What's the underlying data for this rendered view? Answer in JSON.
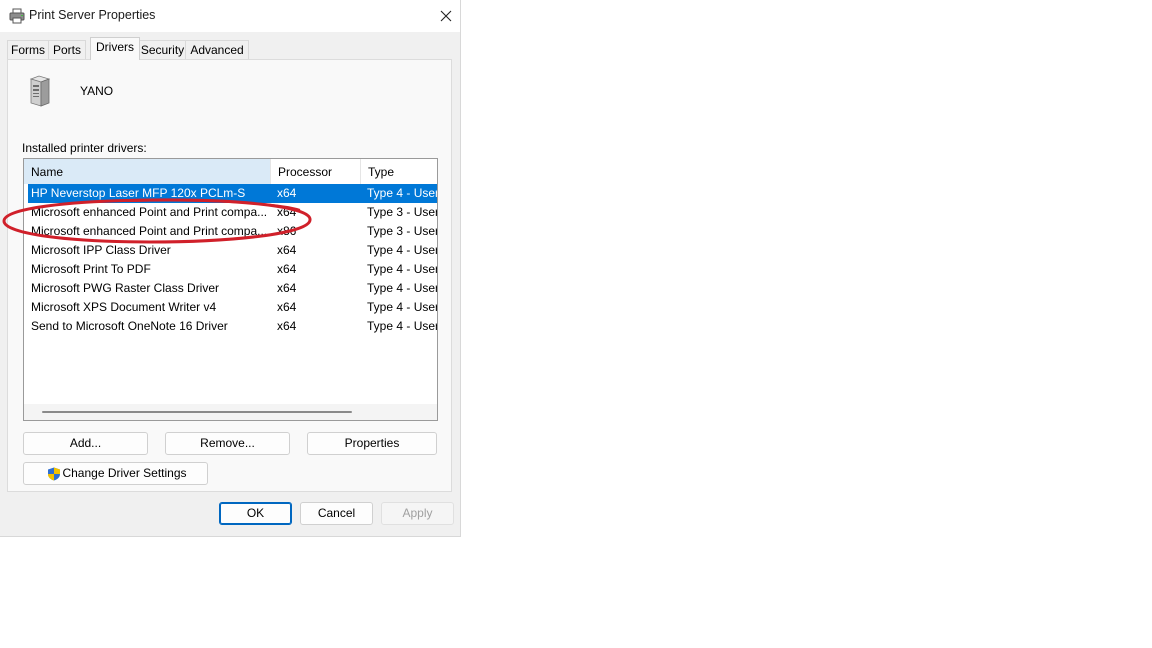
{
  "window": {
    "title": "Print Server Properties",
    "close_icon": "close-icon",
    "title_icon": "printer-icon"
  },
  "tabs": [
    {
      "label": "Forms"
    },
    {
      "label": "Ports"
    },
    {
      "label": "Drivers",
      "active": true
    },
    {
      "label": "Security"
    },
    {
      "label": "Advanced"
    }
  ],
  "server": {
    "name": "YANO",
    "icon": "server-tower-icon"
  },
  "drivers": {
    "label": "Installed printer drivers:",
    "columns": {
      "name": "Name",
      "processor": "Processor",
      "type": "Type"
    },
    "rows": [
      {
        "name": "HP Neverstop Laser MFP 120x PCLm-S",
        "processor": "x64",
        "type": "Type 4 - User",
        "selected": true
      },
      {
        "name": "Microsoft enhanced Point and Print compa...",
        "processor": "x64",
        "type": "Type 3 - User"
      },
      {
        "name": "Microsoft enhanced Point and Print compa...",
        "processor": "x86",
        "type": "Type 3 - User"
      },
      {
        "name": "Microsoft IPP Class Driver",
        "processor": "x64",
        "type": "Type 4 - User"
      },
      {
        "name": "Microsoft Print To PDF",
        "processor": "x64",
        "type": "Type 4 - User"
      },
      {
        "name": "Microsoft PWG Raster Class Driver",
        "processor": "x64",
        "type": "Type 4 - User"
      },
      {
        "name": "Microsoft XPS Document Writer v4",
        "processor": "x64",
        "type": "Type 4 - User"
      },
      {
        "name": "Send to Microsoft OneNote 16 Driver",
        "processor": "x64",
        "type": "Type 4 - User"
      }
    ]
  },
  "buttons": {
    "add": "Add...",
    "remove": "Remove...",
    "properties": "Properties",
    "change_driver_settings": "Change Driver Settings",
    "ok": "OK",
    "cancel": "Cancel",
    "apply": "Apply"
  },
  "annotation": {
    "color": "#d0202a",
    "icon": "red-ellipse-annotation"
  },
  "colors": {
    "selection": "#0078d7",
    "header_highlight": "#daeaf7",
    "default_button_border": "#0067c0",
    "shield_blue": "#2f6fd0",
    "shield_yellow": "#f2c200"
  }
}
